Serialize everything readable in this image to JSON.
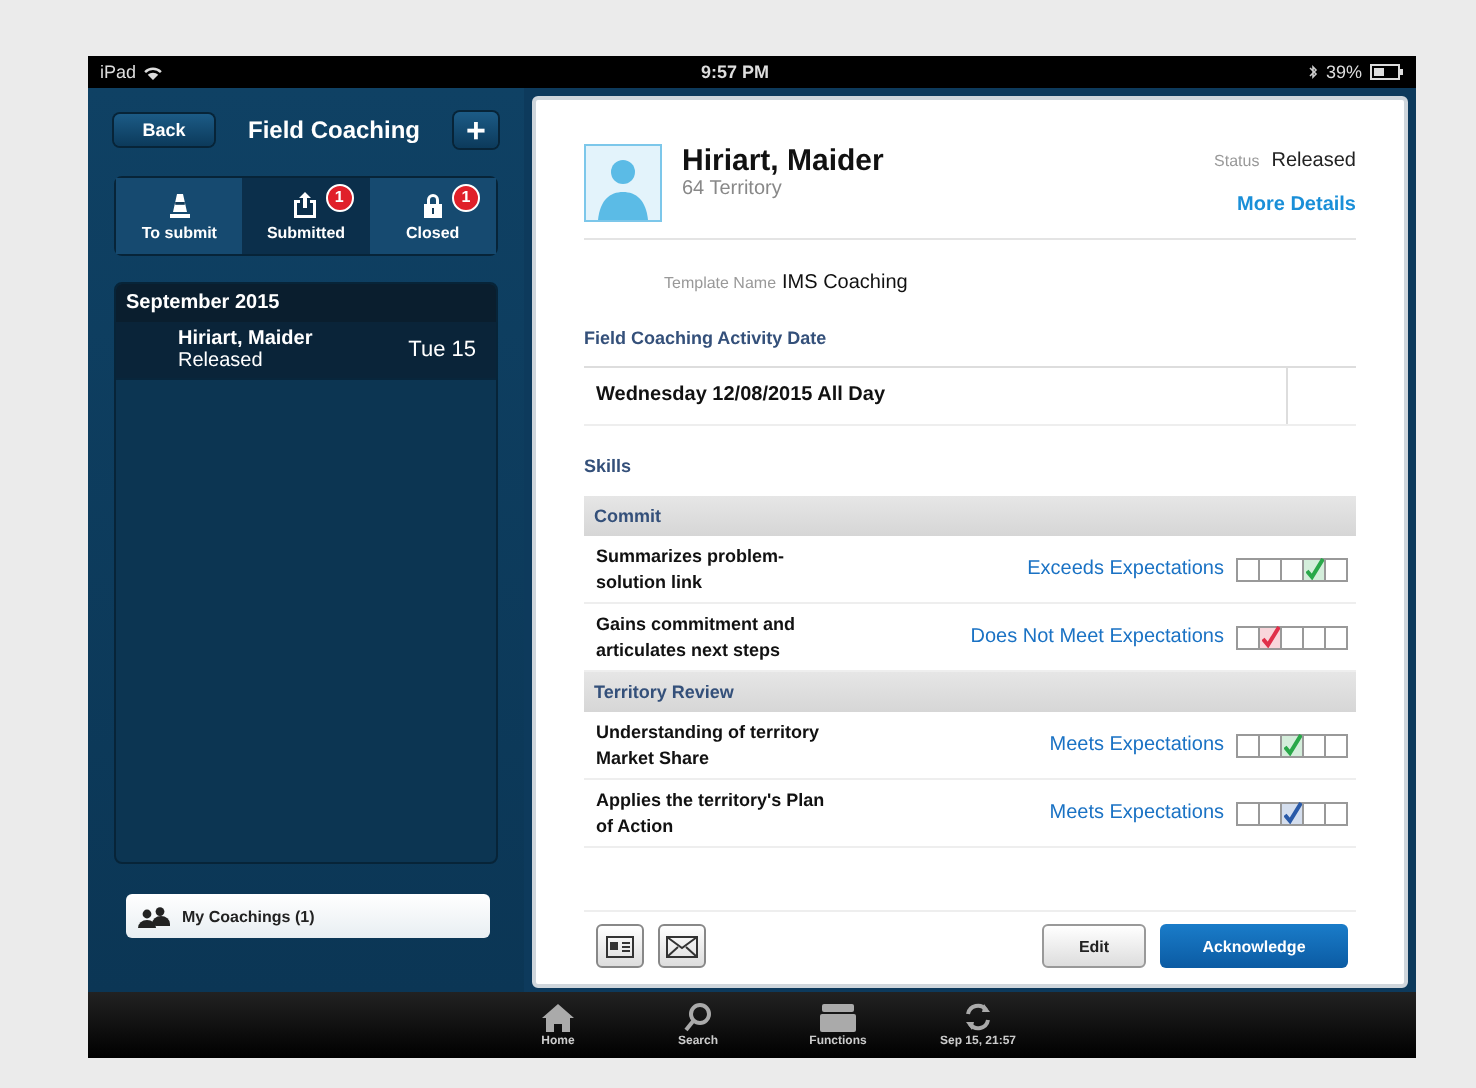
{
  "status_bar": {
    "device": "iPad",
    "time": "9:57 PM",
    "battery": "39%"
  },
  "sidebar": {
    "back": "Back",
    "title": "Field Coaching",
    "add": "+",
    "segments": [
      {
        "label": "To submit",
        "selected": false
      },
      {
        "label": "Submitted",
        "badge": "1",
        "selected": true
      },
      {
        "label": "Closed",
        "badge": "1",
        "selected": false
      }
    ],
    "section": "September 2015",
    "items": [
      {
        "name": "Hiriart, Maider",
        "status": "Released",
        "date": "Tue 15",
        "selected": true
      }
    ],
    "my_coachings": "My Coachings (1)"
  },
  "detail": {
    "name": "Hiriart, Maider",
    "territory": "64 Territory",
    "status_label": "Status",
    "status": "Released",
    "more": "More Details",
    "template_label": "Template Name",
    "template": "IMS Coaching",
    "date_heading": "Field Coaching Activity Date",
    "date": "Wednesday 12/08/2015 All Day",
    "skills_heading": "Skills",
    "groups": [
      {
        "title": "Commit",
        "skills": [
          {
            "name": "Summarizes problem-solution link",
            "rating": "Exceeds Expectations",
            "boxes": [
              {
                "checked": false
              },
              {
                "checked": false
              },
              {
                "checked": false
              },
              {
                "checked": true
              },
              {
                "checked": false
              }
            ],
            "color": "#2aa84a"
          },
          {
            "name": "Gains commitment and articulates next steps",
            "rating": "Does Not Meet Expectations",
            "boxes": [
              {
                "checked": false
              },
              {
                "checked": true
              },
              {
                "checked": false
              },
              {
                "checked": false
              },
              {
                "checked": false
              }
            ],
            "color": "#e0304a"
          }
        ]
      },
      {
        "title": "Territory Review",
        "skills": [
          {
            "name": "Understanding of territory Market Share",
            "rating": "Meets Expectations",
            "boxes": [
              {
                "checked": false
              },
              {
                "checked": false
              },
              {
                "checked": true
              },
              {
                "checked": false
              },
              {
                "checked": false
              }
            ],
            "color": "#2aa84a"
          },
          {
            "name": "Applies the territory's Plan of Action",
            "rating": "Meets Expectations",
            "boxes": [
              {
                "checked": false
              },
              {
                "checked": false
              },
              {
                "checked": true
              },
              {
                "checked": false
              },
              {
                "checked": false
              }
            ],
            "color": "#2a5aa8"
          }
        ]
      }
    ],
    "edit": "Edit",
    "acknowledge": "Acknowledge"
  },
  "tabbar": [
    {
      "label": "Home"
    },
    {
      "label": "Search"
    },
    {
      "label": "Functions"
    },
    {
      "label": "Sep 15, 21:57"
    }
  ]
}
